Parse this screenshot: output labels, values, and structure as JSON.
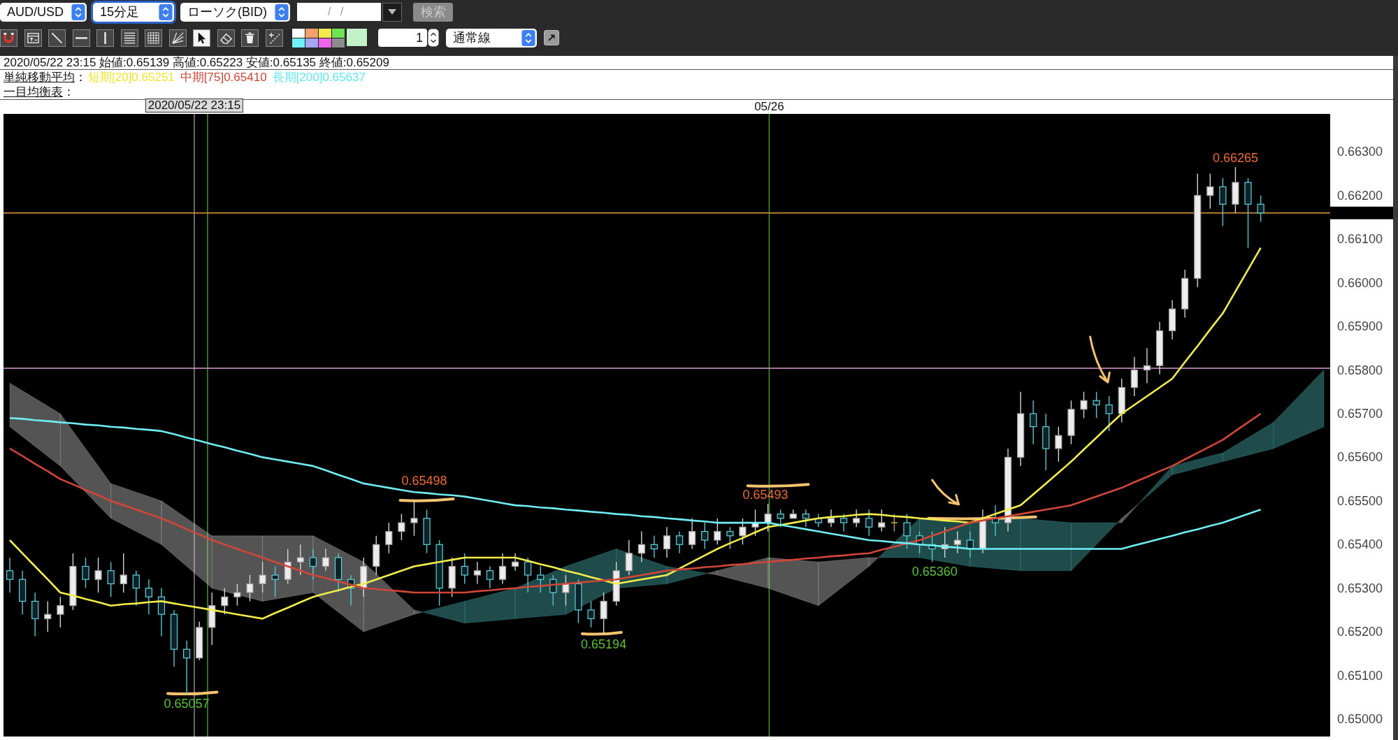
{
  "toolbar": {
    "selects": [
      {
        "value": "AUD/USD",
        "focused": false
      },
      {
        "value": "15分足",
        "focused": true
      },
      {
        "value": "ローソク(BID)",
        "focused": false
      }
    ],
    "date_field": {
      "placeholder": "/   /"
    },
    "search_button": {
      "label": "検索",
      "disabled": true
    },
    "tools": [
      {
        "kind": "magnet",
        "selected": false
      },
      {
        "kind": "text-box",
        "selected": false
      },
      {
        "kind": "diagonal-line",
        "selected": false
      },
      {
        "kind": "horizontal-line",
        "selected": false
      },
      {
        "kind": "vertical-line",
        "selected": false
      },
      {
        "kind": "stacked-lines",
        "selected": false
      },
      {
        "kind": "grid",
        "selected": false
      },
      {
        "kind": "fan",
        "selected": false
      },
      {
        "kind": "cursor",
        "selected": true
      },
      {
        "kind": "eraser",
        "selected": false
      },
      {
        "kind": "trash",
        "selected": false
      },
      {
        "kind": "dashed-line",
        "selected": false
      }
    ],
    "palette": {
      "swatches": [
        {
          "color": "#ffffff"
        },
        {
          "color": "#f5a06a"
        },
        {
          "color": "#f4e94a"
        },
        {
          "color": "#6ee454"
        },
        {
          "color": "#6ef2f8"
        },
        {
          "color": "#a4a8f4"
        },
        {
          "color": "#ee62ee"
        },
        {
          "color": "#8c8c8c"
        }
      ],
      "current": {
        "color": "#c4f2c8"
      }
    },
    "line_width": {
      "value": "1"
    },
    "line_style": {
      "value": "通常線"
    }
  },
  "info": {
    "ohlc_line": "2020/05/22 23:15 始値:0.65139 高値:0.65223 安値:0.65135 終値:0.65209",
    "sma": {
      "label": "単純移動平均",
      "separator": "：",
      "items": [
        {
          "text": "短期[20]0.65251",
          "color": "#efe62c"
        },
        {
          "text": "中期[75]0.65410",
          "color": "#cf4637"
        },
        {
          "text": "長期[200]0.65637",
          "color": "#5ee8f0"
        }
      ]
    },
    "ichimoku": {
      "label": "一目均衡表",
      "separator": "："
    }
  },
  "chart": {
    "crosshair_label": "2020/05/22 23:15",
    "date_labels": [
      {
        "text": "05/26"
      }
    ],
    "price_labels": [
      {
        "text": "0.66265",
        "color": "#ee6c2e"
      },
      {
        "text": "0.65498",
        "color": "#ee6c2e"
      },
      {
        "text": "0.65493",
        "color": "#ee6c2e"
      },
      {
        "text": "0.65057",
        "color": "#58c42a"
      },
      {
        "text": "0.65194",
        "color": "#58c42a"
      },
      {
        "text": "0.65360",
        "color": "#58c42a"
      }
    ],
    "chart_data": {
      "type": "candlestick",
      "ylim": [
        0.6496,
        0.66387
      ],
      "categories": [
        null,
        null,
        null,
        null,
        null,
        null,
        null,
        null,
        null,
        null,
        null,
        null,
        null,
        null,
        null,
        null,
        null,
        null,
        null,
        null,
        null,
        null,
        null,
        null,
        null,
        null,
        null,
        null,
        null,
        null,
        null,
        null,
        null,
        null,
        null,
        null,
        null,
        null,
        null,
        null,
        null,
        null,
        null,
        null,
        null,
        null,
        null,
        null,
        null,
        null,
        null,
        null,
        null,
        null,
        null,
        null,
        null,
        null,
        null,
        null,
        null,
        null,
        null,
        null,
        null,
        null,
        null,
        null,
        null,
        null,
        null,
        null,
        null,
        null,
        null,
        null,
        null,
        null,
        null,
        null,
        null,
        null,
        null,
        null,
        null,
        null,
        null,
        null,
        null,
        null,
        null,
        null,
        null,
        null,
        null,
        null,
        null,
        null,
        null,
        null,
        null,
        null,
        null,
        null,
        null
      ],
      "yticks": [
        {
          "value": 0.663,
          "label": "0.66300"
        },
        {
          "value": 0.662,
          "label": "0.66200"
        },
        {
          "value": 0.661,
          "label": "0.66100"
        },
        {
          "value": 0.66,
          "label": "0.66000"
        },
        {
          "value": 0.659,
          "label": "0.65900"
        },
        {
          "value": 0.658,
          "label": "0.65800"
        },
        {
          "value": 0.657,
          "label": "0.65700"
        },
        {
          "value": 0.656,
          "label": "0.65600"
        },
        {
          "value": 0.655,
          "label": "0.65500"
        },
        {
          "value": 0.654,
          "label": "0.65400"
        },
        {
          "value": 0.653,
          "label": "0.65300"
        },
        {
          "value": 0.652,
          "label": "0.65200"
        },
        {
          "value": 0.651,
          "label": "0.65100"
        },
        {
          "value": 0.65,
          "label": "0.65000"
        }
      ],
      "ohlc": [
        [
          0.6534,
          0.6537,
          0.6529,
          0.6532
        ],
        [
          0.6532,
          0.6534,
          0.6524,
          0.6527
        ],
        [
          0.6527,
          0.6529,
          0.6519,
          0.6523
        ],
        [
          0.6523,
          0.6527,
          0.652,
          0.6524
        ],
        [
          0.6524,
          0.6528,
          0.6521,
          0.6526
        ],
        [
          0.6526,
          0.6538,
          0.6525,
          0.6535
        ],
        [
          0.6535,
          0.6537,
          0.653,
          0.6532
        ],
        [
          0.6532,
          0.6537,
          0.6529,
          0.6534
        ],
        [
          0.6534,
          0.6536,
          0.6528,
          0.6531
        ],
        [
          0.6531,
          0.6538,
          0.6529,
          0.6533
        ],
        [
          0.6533,
          0.6534,
          0.6526,
          0.653
        ],
        [
          0.653,
          0.6532,
          0.6524,
          0.6528
        ],
        [
          0.6528,
          0.653,
          0.6519,
          0.6524
        ],
        [
          0.6524,
          0.6525,
          0.6512,
          0.6516
        ],
        [
          0.6516,
          0.6518,
          0.65057,
          0.6514
        ],
        [
          0.6514,
          0.65223,
          0.65135,
          0.6521
        ],
        [
          0.6521,
          0.6529,
          0.6517,
          0.6526
        ],
        [
          0.6526,
          0.653,
          0.6524,
          0.6528
        ],
        [
          0.6528,
          0.6531,
          0.6526,
          0.6529
        ],
        [
          0.6529,
          0.6533,
          0.6527,
          0.6531
        ],
        [
          0.6531,
          0.6536,
          0.6529,
          0.6533
        ],
        [
          0.6533,
          0.6535,
          0.6528,
          0.6532
        ],
        [
          0.6532,
          0.6539,
          0.6531,
          0.6536
        ],
        [
          0.6536,
          0.654,
          0.6533,
          0.6537
        ],
        [
          0.6537,
          0.6539,
          0.6532,
          0.6535
        ],
        [
          0.6535,
          0.6539,
          0.6534,
          0.6537
        ],
        [
          0.6537,
          0.6538,
          0.6529,
          0.6532
        ],
        [
          0.6532,
          0.6533,
          0.6526,
          0.653
        ],
        [
          0.653,
          0.6537,
          0.6528,
          0.6535
        ],
        [
          0.6535,
          0.6542,
          0.6533,
          0.654
        ],
        [
          0.654,
          0.6545,
          0.6538,
          0.6543
        ],
        [
          0.6543,
          0.6547,
          0.6541,
          0.6545
        ],
        [
          0.6545,
          0.65498,
          0.6542,
          0.6546
        ],
        [
          0.6546,
          0.6548,
          0.6538,
          0.654
        ],
        [
          0.654,
          0.6541,
          0.6526,
          0.653
        ],
        [
          0.653,
          0.6537,
          0.6528,
          0.6535
        ],
        [
          0.6535,
          0.6538,
          0.6531,
          0.6533
        ],
        [
          0.6533,
          0.6536,
          0.6531,
          0.6534
        ],
        [
          0.6534,
          0.6535,
          0.653,
          0.6532
        ],
        [
          0.6532,
          0.6538,
          0.6531,
          0.6535
        ],
        [
          0.6535,
          0.6538,
          0.6534,
          0.6536
        ],
        [
          0.6536,
          0.6537,
          0.6529,
          0.6533
        ],
        [
          0.6533,
          0.6535,
          0.6529,
          0.6532
        ],
        [
          0.6532,
          0.6533,
          0.6526,
          0.6529
        ],
        [
          0.6529,
          0.6533,
          0.6526,
          0.6531
        ],
        [
          0.6531,
          0.6532,
          0.6522,
          0.6525
        ],
        [
          0.6525,
          0.6527,
          0.6521,
          0.6523
        ],
        [
          0.6523,
          0.6529,
          0.65194,
          0.6527
        ],
        [
          0.6527,
          0.6536,
          0.6526,
          0.6534
        ],
        [
          0.6534,
          0.6541,
          0.6533,
          0.6538
        ],
        [
          0.6538,
          0.6543,
          0.6536,
          0.654
        ],
        [
          0.654,
          0.6542,
          0.6537,
          0.6539
        ],
        [
          0.6539,
          0.6544,
          0.6537,
          0.6542
        ],
        [
          0.6542,
          0.6543,
          0.6538,
          0.654
        ],
        [
          0.654,
          0.6546,
          0.6539,
          0.6543
        ],
        [
          0.6543,
          0.6545,
          0.6539,
          0.6541
        ],
        [
          0.6541,
          0.6546,
          0.654,
          0.6543
        ],
        [
          0.6543,
          0.6544,
          0.6539,
          0.6542
        ],
        [
          0.6542,
          0.6546,
          0.654,
          0.6544
        ],
        [
          0.6544,
          0.6548,
          0.6542,
          0.6545
        ],
        [
          0.6545,
          0.65493,
          0.6543,
          0.6547
        ],
        [
          0.6547,
          0.6548,
          0.6544,
          0.6546
        ],
        [
          0.6546,
          0.6548,
          0.6546,
          0.6547
        ],
        [
          0.6547,
          0.6548,
          0.6544,
          0.6546
        ],
        [
          0.6546,
          0.6547,
          0.6544,
          0.6545
        ],
        [
          0.6545,
          0.6548,
          0.6544,
          0.6546
        ],
        [
          0.6546,
          0.6547,
          0.6543,
          0.6545
        ],
        [
          0.6545,
          0.6548,
          0.6544,
          0.6546
        ],
        [
          0.6546,
          0.6548,
          0.6542,
          0.6544
        ],
        [
          0.6544,
          0.6548,
          0.6543,
          0.6545
        ],
        [
          0.6545,
          0.6547,
          0.6543,
          0.6545
        ],
        [
          0.6545,
          0.6547,
          0.6539,
          0.6542
        ],
        [
          0.6542,
          0.6543,
          0.6538,
          0.654
        ],
        [
          0.654,
          0.6543,
          0.6536,
          0.6539
        ],
        [
          0.6539,
          0.6544,
          0.6537,
          0.654
        ],
        [
          0.654,
          0.6543,
          0.6538,
          0.6541
        ],
        [
          0.6541,
          0.6543,
          0.6537,
          0.6539
        ],
        [
          0.6539,
          0.6548,
          0.6538,
          0.6546
        ],
        [
          0.6546,
          0.6549,
          0.6542,
          0.6545
        ],
        [
          0.6545,
          0.6562,
          0.6543,
          0.656
        ],
        [
          0.656,
          0.6575,
          0.6558,
          0.657
        ],
        [
          0.657,
          0.6573,
          0.6563,
          0.6567
        ],
        [
          0.6567,
          0.657,
          0.6557,
          0.6562
        ],
        [
          0.6562,
          0.6567,
          0.6559,
          0.6565
        ],
        [
          0.6565,
          0.6573,
          0.6563,
          0.6571
        ],
        [
          0.6571,
          0.6575,
          0.6569,
          0.6573
        ],
        [
          0.6573,
          0.6575,
          0.6569,
          0.6572
        ],
        [
          0.6572,
          0.6574,
          0.6566,
          0.657
        ],
        [
          0.657,
          0.6578,
          0.6568,
          0.6576
        ],
        [
          0.6576,
          0.6583,
          0.6574,
          0.658
        ],
        [
          0.658,
          0.6585,
          0.6577,
          0.6581
        ],
        [
          0.6581,
          0.6591,
          0.6579,
          0.6589
        ],
        [
          0.6589,
          0.6596,
          0.6587,
          0.6594
        ],
        [
          0.6594,
          0.6603,
          0.6592,
          0.6601
        ],
        [
          0.6601,
          0.6625,
          0.6599,
          0.662
        ],
        [
          0.662,
          0.6625,
          0.6617,
          0.6622
        ],
        [
          0.6622,
          0.6624,
          0.6613,
          0.6618
        ],
        [
          0.6618,
          0.66265,
          0.6616,
          0.6623
        ],
        [
          0.6623,
          0.6624,
          0.6608,
          0.6618
        ],
        [
          0.6618,
          0.662,
          0.6614,
          0.6616
        ],
        null,
        null,
        null,
        null,
        null
      ],
      "series": [
        {
          "type": "line",
          "color": "#f3ee4a",
          "values": [
            0.6541,
            0.6538,
            0.6535,
            0.6532,
            0.6529,
            0.65283,
            0.65275,
            0.65268,
            0.6526,
            0.65263,
            0.65265,
            0.65268,
            0.6527,
            0.65265,
            0.6526,
            0.65255,
            0.6525,
            0.65245,
            0.6524,
            0.65235,
            0.6523,
            0.65243,
            0.65255,
            0.65268,
            0.6528,
            0.65288,
            0.65295,
            0.65303,
            0.6531,
            0.6532,
            0.6533,
            0.6534,
            0.6535,
            0.65355,
            0.6536,
            0.65365,
            0.6537,
            0.6537,
            0.6537,
            0.6537,
            0.6537,
            0.65363,
            0.65355,
            0.65348,
            0.6534,
            0.65333,
            0.65325,
            0.65318,
            0.6531,
            0.65315,
            0.6532,
            0.65325,
            0.6533,
            0.65345,
            0.6536,
            0.65375,
            0.6539,
            0.65403,
            0.65415,
            0.65428,
            0.6544,
            0.65445,
            0.6545,
            0.65455,
            0.6546,
            0.65463,
            0.65465,
            0.65468,
            0.6547,
            0.65468,
            0.65465,
            0.65463,
            0.6546,
            0.65458,
            0.65455,
            0.65453,
            0.6545,
            0.6546,
            0.6547,
            0.6548,
            0.6549,
            0.65515,
            0.6554,
            0.65565,
            0.6559,
            0.65618,
            0.65645,
            0.65673,
            0.657,
            0.6572,
            0.6574,
            0.6576,
            0.6578,
            0.65818,
            0.65855,
            0.65893,
            0.6593,
            0.6598,
            0.6603,
            0.6608,
            null,
            null,
            null,
            null,
            null
          ]
        },
        {
          "type": "line",
          "color": "#d2463a",
          "values": [
            0.6562,
            0.65603,
            0.65585,
            0.65568,
            0.6555,
            0.65538,
            0.65525,
            0.65513,
            0.655,
            0.6549,
            0.6548,
            0.6547,
            0.6546,
            0.65448,
            0.65435,
            0.65423,
            0.6541,
            0.654,
            0.6539,
            0.6538,
            0.6537,
            0.6536,
            0.6535,
            0.6534,
            0.6533,
            0.65323,
            0.65315,
            0.65308,
            0.653,
            0.65298,
            0.65295,
            0.65293,
            0.6529,
            0.6529,
            0.6529,
            0.6529,
            0.6529,
            0.65293,
            0.65295,
            0.65298,
            0.653,
            0.65303,
            0.65305,
            0.65308,
            0.6531,
            0.65313,
            0.65315,
            0.65318,
            0.6532,
            0.65325,
            0.6533,
            0.65335,
            0.6534,
            0.65343,
            0.65345,
            0.65348,
            0.6535,
            0.65353,
            0.65355,
            0.65358,
            0.6536,
            0.65363,
            0.65365,
            0.65368,
            0.6537,
            0.65373,
            0.65375,
            0.65378,
            0.6538,
            0.65388,
            0.65395,
            0.65403,
            0.6541,
            0.6542,
            0.6543,
            0.6544,
            0.6545,
            0.65455,
            0.6546,
            0.65465,
            0.6547,
            0.65475,
            0.6548,
            0.65485,
            0.6549,
            0.655,
            0.6551,
            0.6552,
            0.6553,
            0.65543,
            0.65555,
            0.65568,
            0.6558,
            0.65595,
            0.6561,
            0.65625,
            0.6564,
            0.6566,
            0.6568,
            0.657,
            null,
            null,
            null,
            null,
            null
          ]
        },
        {
          "type": "line",
          "color": "#70eef4",
          "values": [
            0.6569,
            0.65688,
            0.65685,
            0.65683,
            0.6568,
            0.65678,
            0.65675,
            0.65673,
            0.6567,
            0.65668,
            0.65665,
            0.65663,
            0.6566,
            0.65653,
            0.65645,
            0.65638,
            0.6563,
            0.65623,
            0.65615,
            0.65608,
            0.656,
            0.65595,
            0.6559,
            0.65585,
            0.6558,
            0.6557,
            0.6556,
            0.6555,
            0.6554,
            0.65535,
            0.6553,
            0.65525,
            0.6552,
            0.65518,
            0.65515,
            0.65513,
            0.6551,
            0.65505,
            0.655,
            0.65495,
            0.6549,
            0.65488,
            0.65485,
            0.65483,
            0.6548,
            0.65478,
            0.65475,
            0.65473,
            0.6547,
            0.65468,
            0.65465,
            0.65463,
            0.6546,
            0.65458,
            0.65455,
            0.65453,
            0.6545,
            0.6545,
            0.6545,
            0.6545,
            0.6545,
            0.65445,
            0.6544,
            0.65435,
            0.6543,
            0.65425,
            0.6542,
            0.65415,
            0.6541,
            0.65408,
            0.65405,
            0.65403,
            0.654,
            0.65398,
            0.65395,
            0.65393,
            0.6539,
            0.6539,
            0.6539,
            0.6539,
            0.6539,
            0.6539,
            0.6539,
            0.6539,
            0.6539,
            0.6539,
            0.6539,
            0.6539,
            0.6539,
            0.65398,
            0.65405,
            0.65413,
            0.6542,
            0.65428,
            0.65435,
            0.65443,
            0.6545,
            0.6546,
            0.6547,
            0.6548,
            null,
            null,
            null,
            null,
            null
          ]
        }
      ],
      "ref_lines": [
        {
          "axis": "y",
          "value": 0.6616,
          "color": "#e39a3c"
        },
        {
          "axis": "y",
          "value": 0.65804,
          "color": "#d79bd4"
        }
      ]
    }
  }
}
